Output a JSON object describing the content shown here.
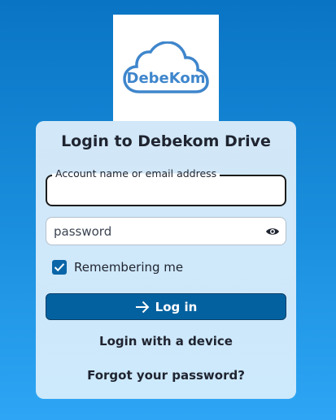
{
  "logo": {
    "text": "DebeKom",
    "icon": "cloud-logo"
  },
  "login": {
    "title": "Login to Debekom Drive",
    "account_label": "Account name or email address",
    "account_value": "",
    "password_placeholder": "password",
    "remember_label": "Remembering me",
    "remember_checked": true,
    "login_button": "Log in",
    "login_device": "Login with a device",
    "forgot_password": "Forgot your password?"
  },
  "colors": {
    "primary": "#04619f",
    "background_top": "#0a74c4",
    "background_bottom": "#2ea6f5",
    "card": "#d2e7f7"
  }
}
